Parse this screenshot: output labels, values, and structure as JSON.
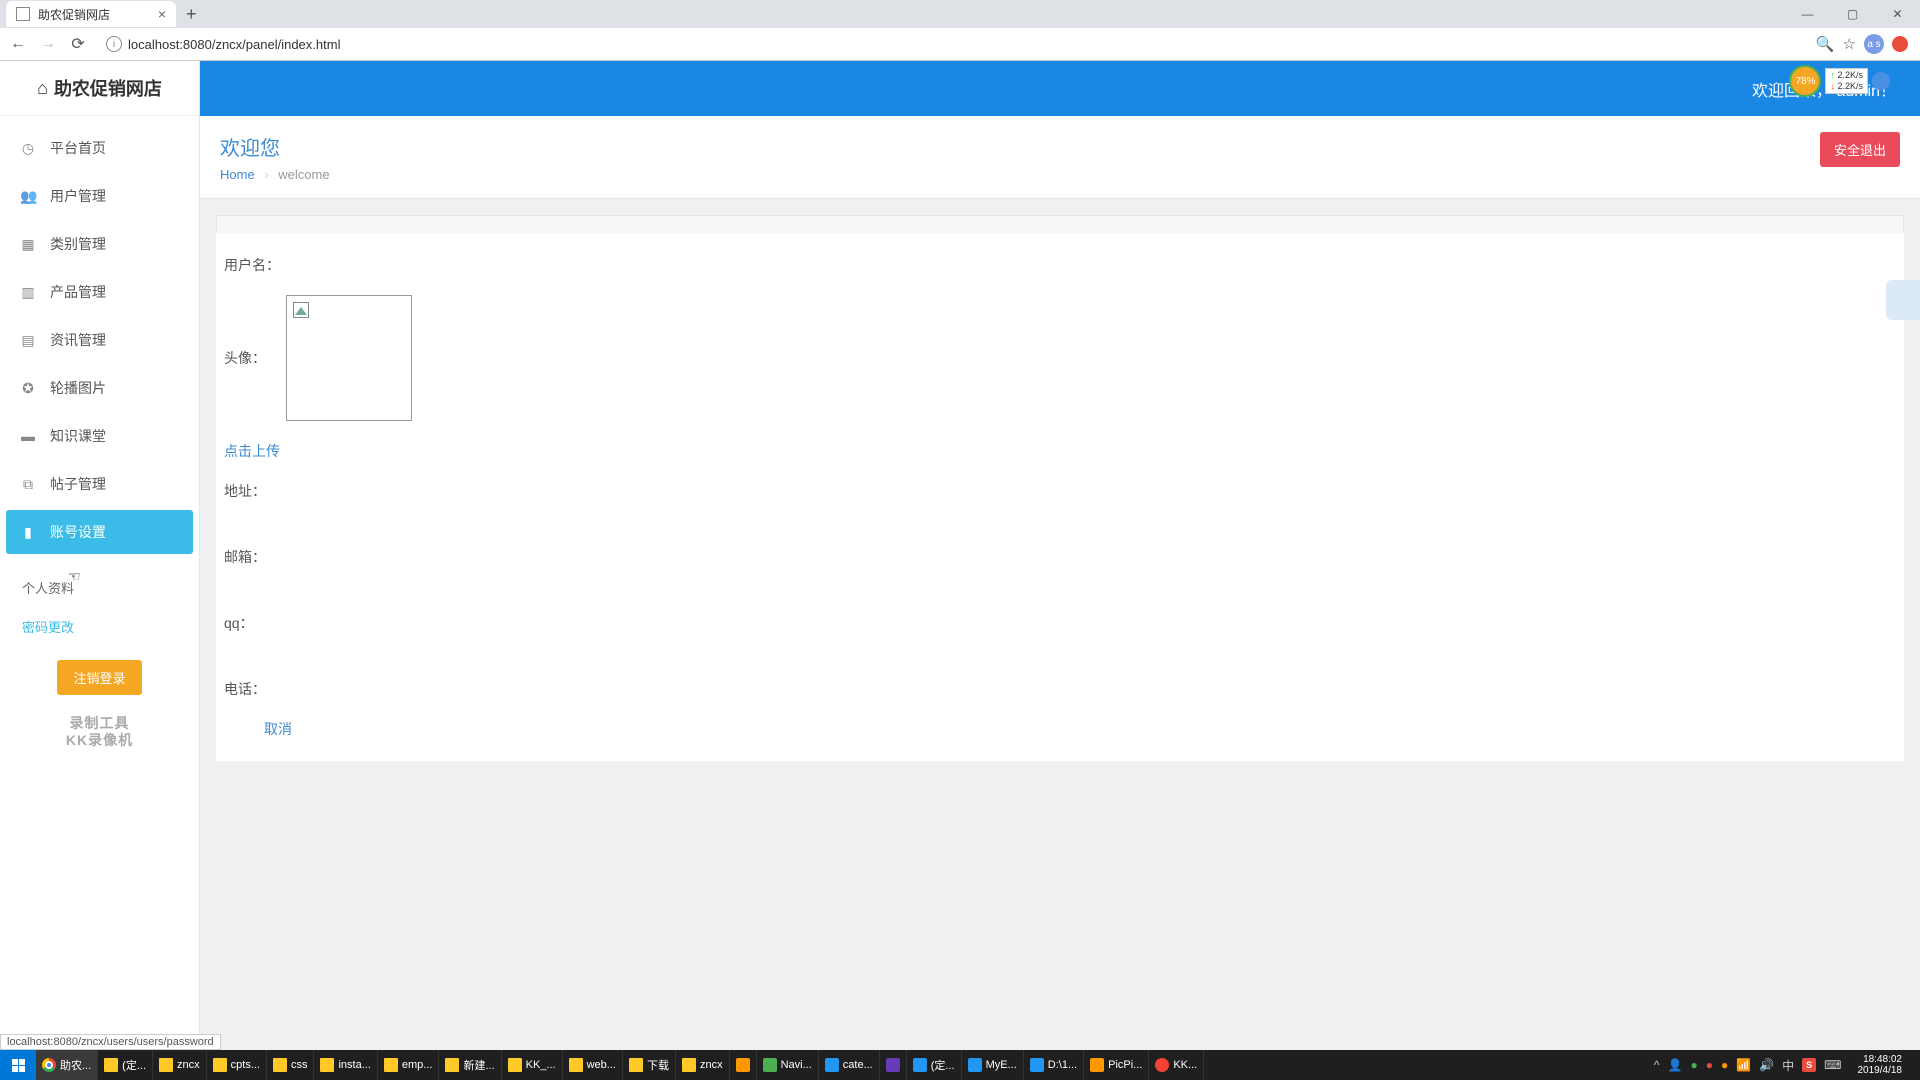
{
  "browser": {
    "tab_title": "助农促销网店",
    "url": "localhost:8080/zncx/panel/index.html",
    "profile_initials": "a s",
    "status_hint": "localhost:8080/zncx/users/users/password"
  },
  "app": {
    "logo_title": "助农促销网店",
    "welcome_text": "欢迎回来，",
    "username": "admin",
    "perf": {
      "percent": "78%",
      "up": "2.2K/s",
      "down": "2.2K/s"
    }
  },
  "sidebar": {
    "items": [
      {
        "icon": "◷",
        "label": "平台首页"
      },
      {
        "icon": "👥",
        "label": "用户管理"
      },
      {
        "icon": "▦",
        "label": "类别管理"
      },
      {
        "icon": "▥",
        "label": "产品管理"
      },
      {
        "icon": "▤",
        "label": "资讯管理"
      },
      {
        "icon": "✪",
        "label": "轮播图片"
      },
      {
        "icon": "▬",
        "label": "知识课堂"
      },
      {
        "icon": "⧉",
        "label": "帖子管理"
      },
      {
        "icon": "▮",
        "label": "账号设置"
      }
    ],
    "sub_items": [
      {
        "label": "个人资料"
      },
      {
        "label": "密码更改"
      }
    ],
    "logout_label": "注销登录",
    "watermark_line1": "录制工具",
    "watermark_line2": "KK录像机"
  },
  "page": {
    "title": "欢迎您",
    "breadcrumb_home": "Home",
    "breadcrumb_current": "welcome",
    "exit_label": "安全退出"
  },
  "form": {
    "username_label": "用户名：",
    "avatar_label": "头像：",
    "upload_link": "点击上传",
    "address_label": "地址：",
    "email_label": "邮箱：",
    "qq_label": "qq：",
    "phone_label": "电话：",
    "cancel_label": "取消"
  },
  "taskbar": {
    "items": [
      {
        "label": "助农...",
        "icon": "chrome",
        "active": true
      },
      {
        "label": "(定...",
        "icon": "folder"
      },
      {
        "label": "zncx",
        "icon": "folder"
      },
      {
        "label": "cpts...",
        "icon": "folder"
      },
      {
        "label": "css",
        "icon": "folder"
      },
      {
        "label": "insta...",
        "icon": "folder"
      },
      {
        "label": "emp...",
        "icon": "folder"
      },
      {
        "label": "新建...",
        "icon": "folder"
      },
      {
        "label": "KK_...",
        "icon": "folder"
      },
      {
        "label": "web...",
        "icon": "folder"
      },
      {
        "label": "下载",
        "icon": "folder"
      },
      {
        "label": "zncx",
        "icon": "folder"
      },
      {
        "label": "",
        "icon": "orange"
      },
      {
        "label": "Navi...",
        "icon": "green"
      },
      {
        "label": "cate...",
        "icon": "blue"
      },
      {
        "label": "",
        "icon": "purple"
      },
      {
        "label": "(定...",
        "icon": "blue"
      },
      {
        "label": "MyE...",
        "icon": "blue"
      },
      {
        "label": "D:\\1...",
        "icon": "blue"
      },
      {
        "label": "PicPi...",
        "icon": "orange"
      },
      {
        "label": "KK...",
        "icon": "red"
      }
    ],
    "clock_time": "18:48:02",
    "clock_date": "2019/4/18",
    "ime": "中"
  }
}
